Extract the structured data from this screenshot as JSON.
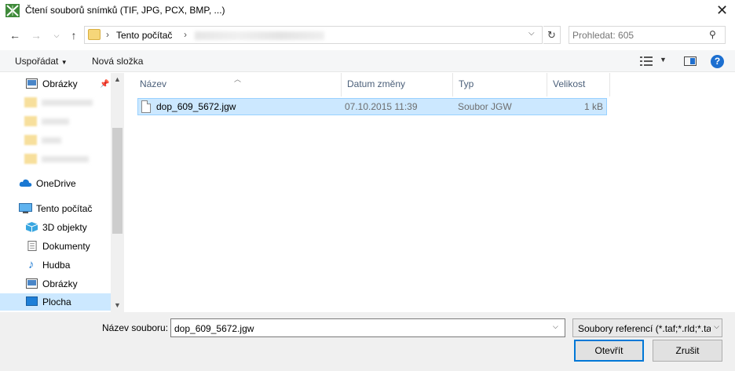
{
  "window": {
    "title": "Čtení souborů snímků (TIF, JPG, PCX, BMP, ...)"
  },
  "address": {
    "root": "Tento počítač",
    "search_placeholder": "Prohledat: 605"
  },
  "toolbar": {
    "organize": "Uspořádat",
    "new_folder": "Nová složka"
  },
  "sidebar": {
    "pinned": "Obrázky",
    "onedrive": "OneDrive",
    "this_pc": "Tento počítač",
    "items": [
      "3D objekty",
      "Dokumenty",
      "Hudba",
      "Obrázky",
      "Plocha"
    ]
  },
  "columns": {
    "name": "Název",
    "date": "Datum změny",
    "type": "Typ",
    "size": "Velikost"
  },
  "files": [
    {
      "name": "dop_609_5672.jgw",
      "date": "07.10.2015 11:39",
      "type": "Soubor JGW",
      "size": "1 kB"
    }
  ],
  "footer": {
    "filename_label": "Název souboru:",
    "filename_value": "dop_609_5672.jgw",
    "filter": "Soubory referencí (*.taf;*.rld;*.tab;*.jgw)",
    "open": "Otevřít",
    "cancel": "Zrušit"
  },
  "colors": {
    "selection": "#cce8ff",
    "accent": "#0078d7",
    "header_text": "#4c607a"
  }
}
